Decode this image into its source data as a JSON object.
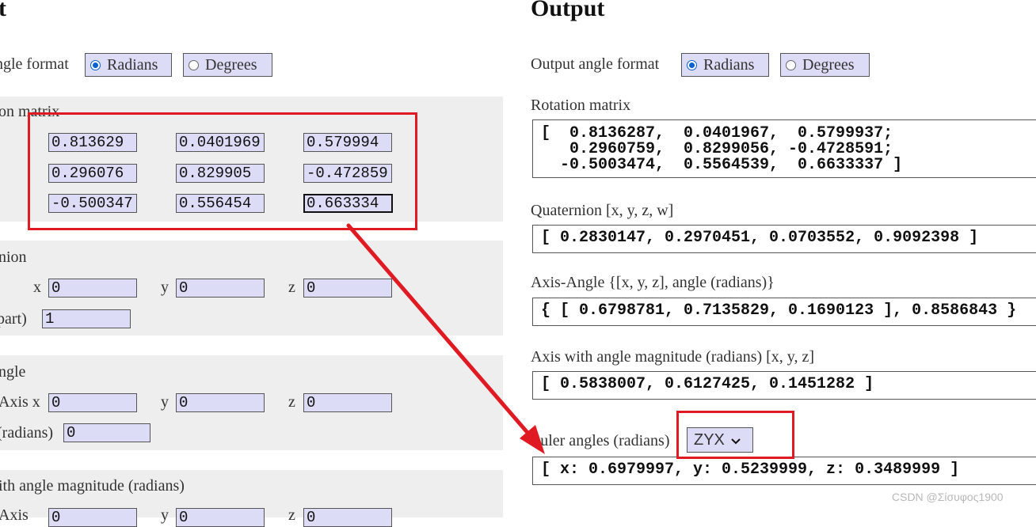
{
  "input": {
    "title": "t",
    "angle_format_label": "ngle format",
    "radio_radians": "Radians",
    "radio_degrees": "Degrees",
    "rotation_matrix_label": "on matrix",
    "matrix": [
      [
        "0.813629",
        "0.0401969",
        "0.579994"
      ],
      [
        "0.296076",
        "0.829905",
        "-0.472859"
      ],
      [
        "-0.500347",
        "0.556454",
        "0.663334"
      ]
    ],
    "quaternion_label": "nion",
    "quat_x_label": "x",
    "quat_x": "0",
    "quat_y_label": "y",
    "quat_y": "0",
    "quat_z_label": "z",
    "quat_z": "0",
    "quat_w_label": " part)",
    "quat_w": "1",
    "axis_angle_label": "ngle",
    "aa_axis_x_label": "Axis x",
    "aa_x": "0",
    "aa_y_label": "y",
    "aa_y": "0",
    "aa_z_label": "z",
    "aa_z": "0",
    "aa_angle_label": "(radians)",
    "aa_angle": "0",
    "axis_mag_label": "ith angle magnitude (radians)",
    "am_axis_label": "Axis",
    "am_y_label": "y",
    "am_z_label": "z",
    "am_x": "0",
    "am_y": "0",
    "am_z": "0"
  },
  "output": {
    "title": "Output",
    "angle_format_label": "Output angle format",
    "radio_radians": "Radians",
    "radio_degrees": "Degrees",
    "rotation_matrix_label": "Rotation matrix",
    "rotation_matrix_value": "[  0.8136287,  0.0401967,  0.5799937;\n   0.2960759,  0.8299056, -0.4728591;\n  -0.5003474,  0.5564539,  0.6633337 ]",
    "quaternion_label": "Quaternion [x, y, z, w]",
    "quaternion_value": "[ 0.2830147, 0.2970451, 0.0703552, 0.9092398 ]",
    "axis_angle_label": "Axis-Angle {[x, y, z], angle (radians)}",
    "axis_angle_value": "{ [ 0.6798781, 0.7135829, 0.1690123 ], 0.8586843 }",
    "axis_mag_label": "Axis with angle magnitude (radians) [x, y, z]",
    "axis_mag_value": "[ 0.5838007, 0.6127425, 0.1451282 ]",
    "euler_label": "Euler angles (radians)",
    "euler_order": "ZYX",
    "euler_value": "[ x: 0.6979997, y: 0.5239999, z: 0.3489999 ]"
  },
  "annotation_color": "#e01a22",
  "watermark": "CSDN @Σίσυφος1900"
}
